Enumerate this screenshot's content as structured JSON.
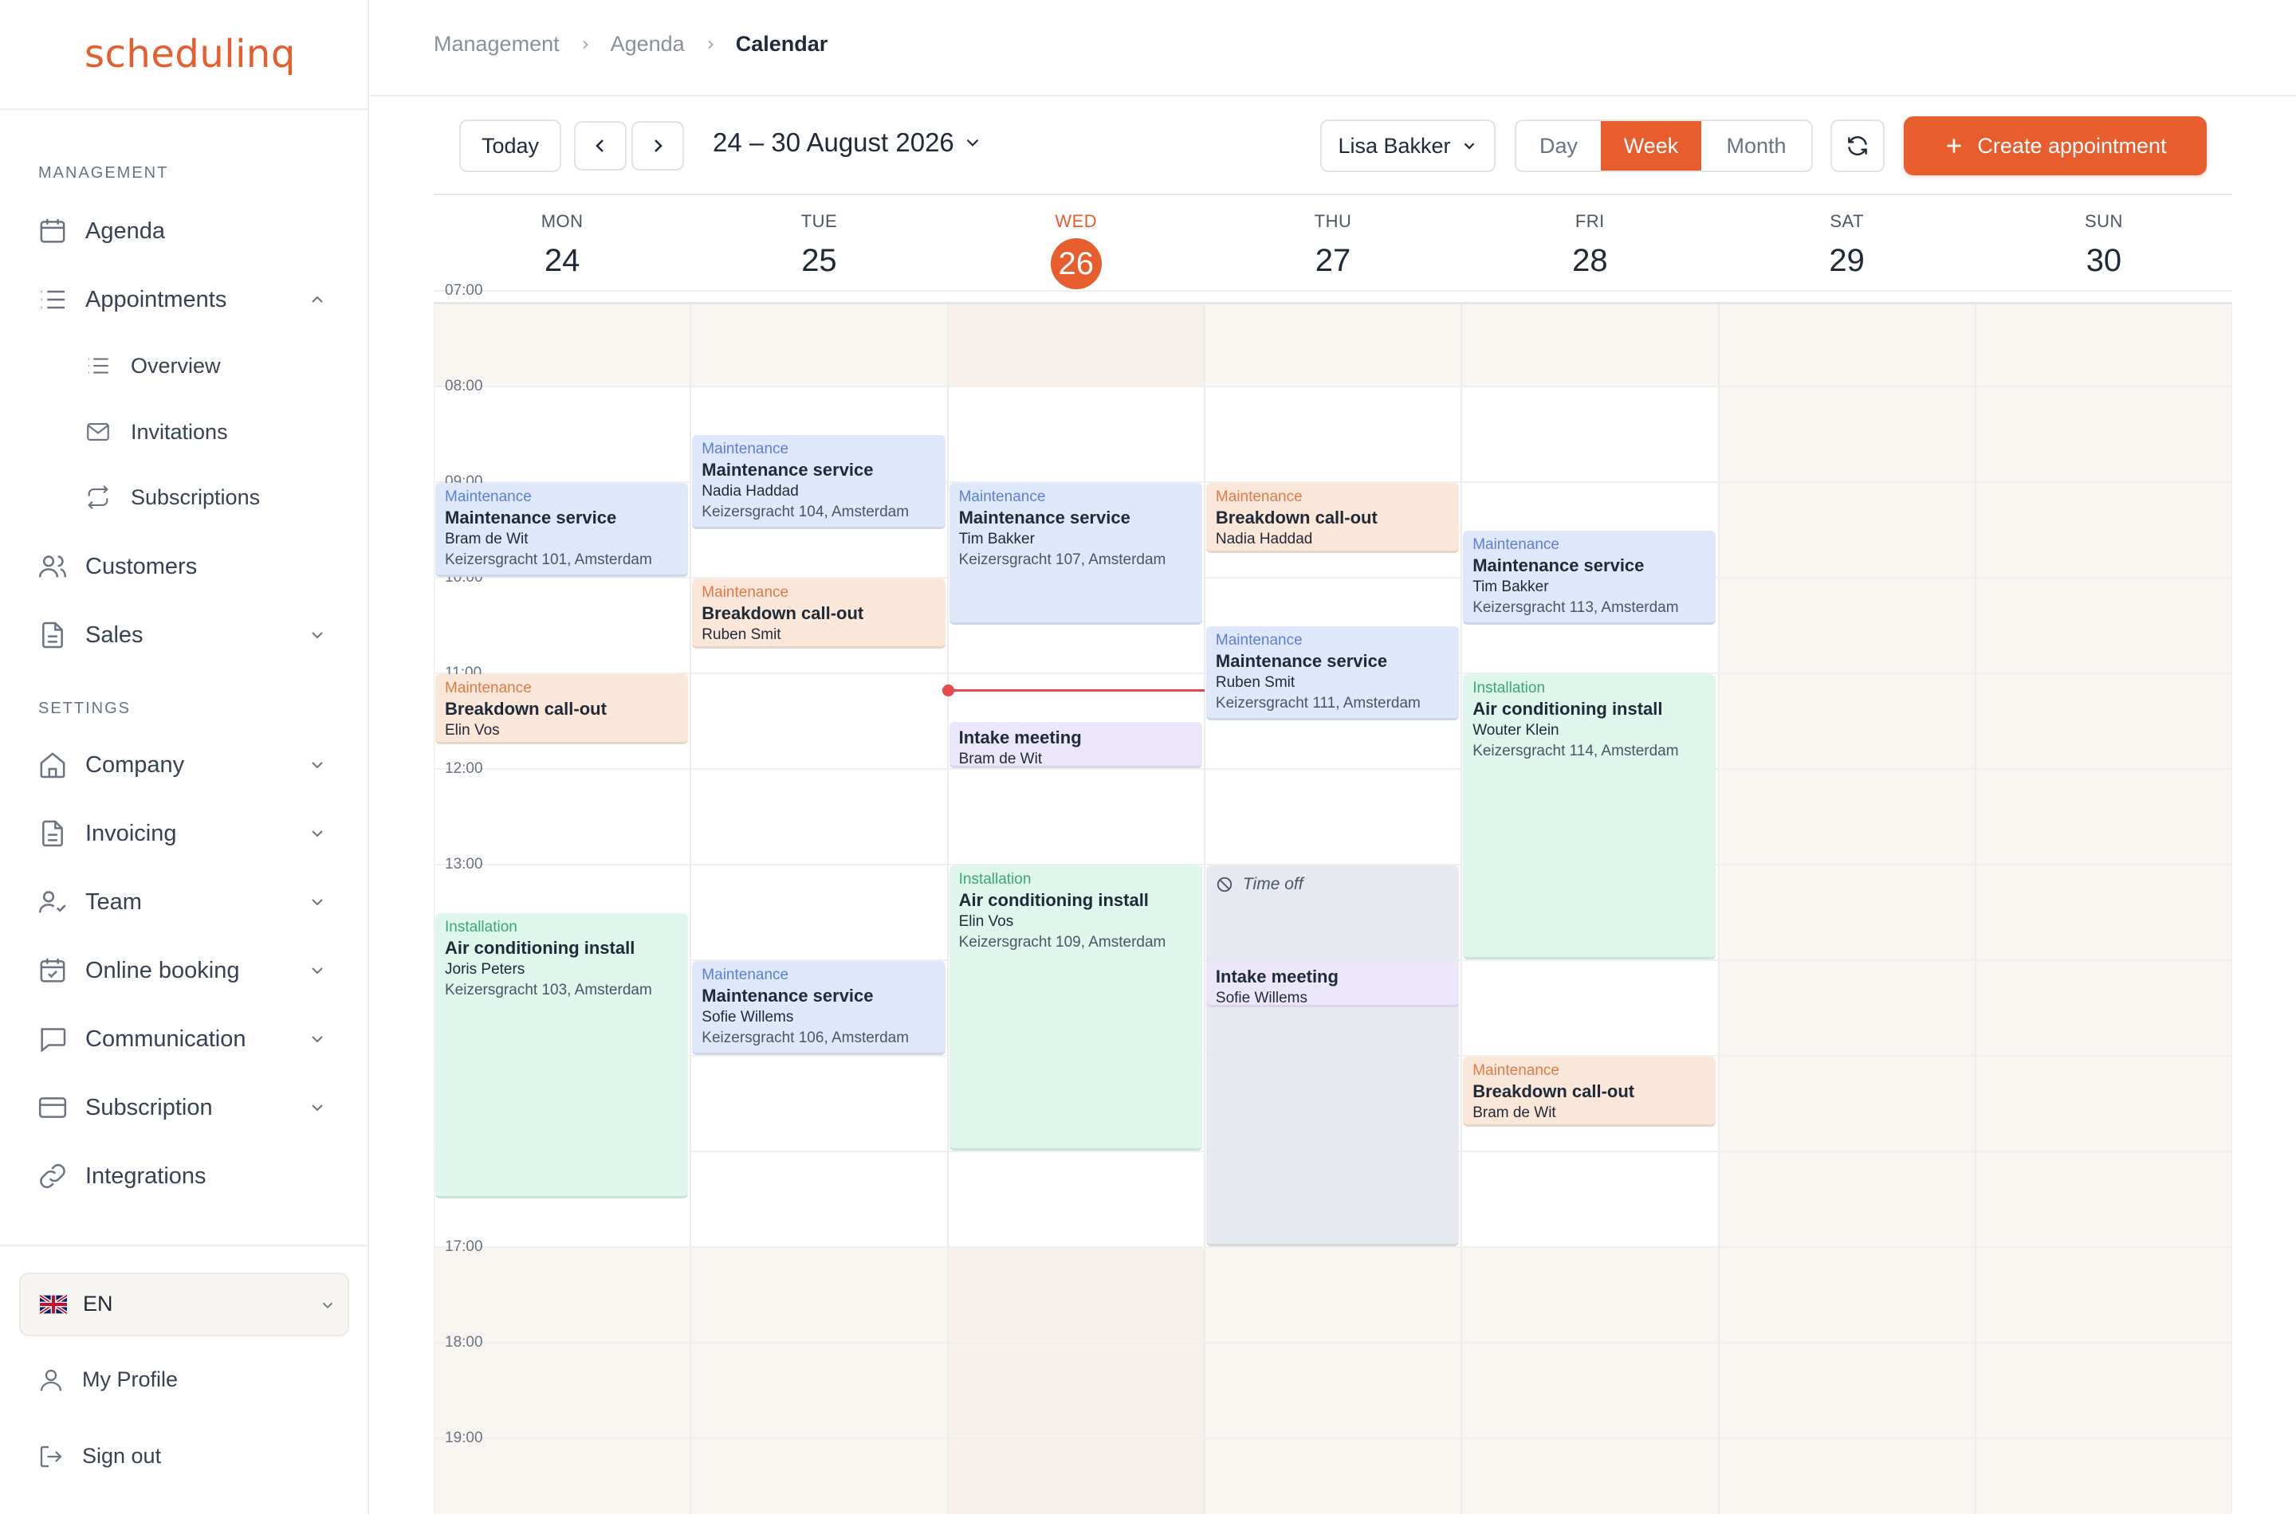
{
  "app": {
    "logo": "schedulinq"
  },
  "sidebar": {
    "management_heading": "MANAGEMENT",
    "settings_heading": "SETTINGS",
    "items": {
      "agenda": "Agenda",
      "appointments": "Appointments",
      "overview": "Overview",
      "invitations": "Invitations",
      "subscriptions": "Subscriptions",
      "customers": "Customers",
      "sales": "Sales",
      "company": "Company",
      "invoicing": "Invoicing",
      "team": "Team",
      "online_booking": "Online booking",
      "communication": "Communication",
      "subscription": "Subscription",
      "integrations": "Integrations"
    },
    "language": "EN",
    "my_profile": "My Profile",
    "sign_out": "Sign out"
  },
  "breadcrumb": {
    "level1": "Management",
    "level2": "Agenda",
    "current": "Calendar"
  },
  "toolbar": {
    "today": "Today",
    "range": "24 – 30 August 2026",
    "staff": "Lisa Bakker",
    "views": {
      "day": "Day",
      "week": "Week",
      "month": "Month"
    },
    "active_view": "Week",
    "create": "Create appointment"
  },
  "colors": {
    "accent": "#e85d2e",
    "now_line": "#e5484d",
    "maintenance": "#dfe8fa",
    "breakdown": "#fbe6da",
    "installation": "#dff6ec",
    "intake": "#ece6fb",
    "time_off": "#e6e9ef"
  },
  "calendar": {
    "days": [
      {
        "name": "MON",
        "num": "24"
      },
      {
        "name": "TUE",
        "num": "25"
      },
      {
        "name": "WED",
        "num": "26",
        "today": true
      },
      {
        "name": "THU",
        "num": "27"
      },
      {
        "name": "FRI",
        "num": "28"
      },
      {
        "name": "SAT",
        "num": "29"
      },
      {
        "name": "SUN",
        "num": "30"
      }
    ],
    "hours": [
      "07:00",
      "08:00",
      "09:00",
      "10:00",
      "11:00",
      "12:00",
      "13:00",
      "14:00",
      "15:00",
      "16:00",
      "17:00",
      "18:00",
      "19:00"
    ],
    "current_time": "11:11",
    "events": [
      {
        "day": 0,
        "start": "09:00",
        "end": "10:00",
        "type": "maint",
        "category": "Maintenance",
        "title": "Maintenance service",
        "customer": "Bram de Wit",
        "address": "Keizersgracht 101, Amsterdam"
      },
      {
        "day": 0,
        "start": "11:00",
        "end": "11:45",
        "type": "break",
        "category": "Maintenance",
        "title": "Breakdown call-out",
        "customer": "Elin Vos",
        "address": ""
      },
      {
        "day": 0,
        "start": "13:30",
        "end": "16:30",
        "type": "install",
        "category": "Installation",
        "title": "Air conditioning install",
        "customer": "Joris Peters",
        "address": "Keizersgracht 103, Amsterdam"
      },
      {
        "day": 1,
        "start": "08:30",
        "end": "09:30",
        "type": "maint",
        "category": "Maintenance",
        "title": "Maintenance service",
        "customer": "Nadia Haddad",
        "address": "Keizersgracht 104, Amsterdam"
      },
      {
        "day": 1,
        "start": "10:00",
        "end": "10:45",
        "type": "break",
        "category": "Maintenance",
        "title": "Breakdown call-out",
        "customer": "Ruben Smit",
        "address": ""
      },
      {
        "day": 1,
        "start": "14:00",
        "end": "15:00",
        "type": "maint",
        "category": "Maintenance",
        "title": "Maintenance service",
        "customer": "Sofie Willems",
        "address": "Keizersgracht 106, Amsterdam"
      },
      {
        "day": 2,
        "start": "09:00",
        "end": "10:30",
        "type": "maint",
        "category": "Maintenance",
        "title": "Maintenance service",
        "customer": "Tim Bakker",
        "address": "Keizersgracht 107, Amsterdam"
      },
      {
        "day": 2,
        "start": "11:30",
        "end": "12:00",
        "type": "intake",
        "category": "",
        "title": "Intake meeting",
        "customer": "Bram de Wit",
        "address": ""
      },
      {
        "day": 2,
        "start": "13:00",
        "end": "16:00",
        "type": "install",
        "category": "Installation",
        "title": "Air conditioning install",
        "customer": "Elin Vos",
        "address": "Keizersgracht 109, Amsterdam"
      },
      {
        "day": 3,
        "start": "09:00",
        "end": "09:45",
        "type": "break",
        "category": "Maintenance",
        "title": "Breakdown call-out",
        "customer": "Nadia Haddad",
        "address": ""
      },
      {
        "day": 3,
        "start": "10:30",
        "end": "11:30",
        "type": "maint",
        "category": "Maintenance",
        "title": "Maintenance service",
        "customer": "Ruben Smit",
        "address": "Keizersgracht 111, Amsterdam"
      },
      {
        "day": 3,
        "start": "13:00",
        "end": "17:00",
        "type": "off",
        "category": "",
        "title": "Time off",
        "customer": "",
        "address": ""
      },
      {
        "day": 3,
        "start": "14:00",
        "end": "14:30",
        "type": "intake",
        "category": "",
        "title": "Intake meeting",
        "customer": "Sofie Willems",
        "address": ""
      },
      {
        "day": 4,
        "start": "09:30",
        "end": "10:30",
        "type": "maint",
        "category": "Maintenance",
        "title": "Maintenance service",
        "customer": "Tim Bakker",
        "address": "Keizersgracht 113, Amsterdam"
      },
      {
        "day": 4,
        "start": "11:00",
        "end": "14:00",
        "type": "install",
        "category": "Installation",
        "title": "Air conditioning install",
        "customer": "Wouter Klein",
        "address": "Keizersgracht 114, Amsterdam"
      },
      {
        "day": 4,
        "start": "15:00",
        "end": "15:45",
        "type": "break",
        "category": "Maintenance",
        "title": "Breakdown call-out",
        "customer": "Bram de Wit",
        "address": ""
      }
    ]
  }
}
